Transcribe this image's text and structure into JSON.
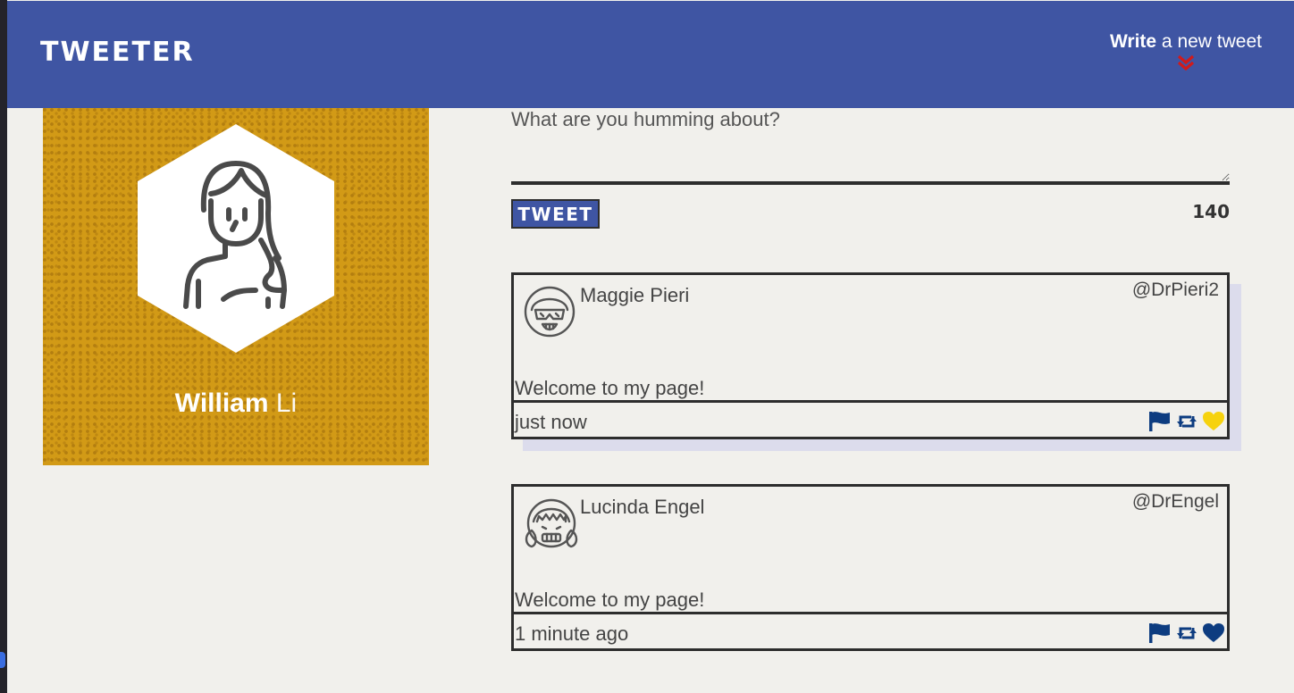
{
  "header": {
    "brand": "TWEETER",
    "compose_bold": "Write",
    "compose_rest": " a new tweet"
  },
  "profile": {
    "first_name": "William",
    "last_name": " Li"
  },
  "composer": {
    "placeholder": "What are you humming about?",
    "submit_label": "TWEET",
    "char_count": "140"
  },
  "tweets": [
    {
      "name": "Maggie Pieri",
      "handle": "@DrPieri2",
      "text": "Welcome to my page!",
      "time": "just now",
      "liked": true
    },
    {
      "name": "Lucinda Engel",
      "handle": "@DrEngel",
      "text": "Welcome to my page!",
      "time": "1 minute ago",
      "liked": false
    }
  ],
  "colors": {
    "header_bg": "#3f55a3",
    "profile_bg": "#d29a16",
    "icon_blue": "#0d3c80",
    "like_active": "#f6d20d",
    "chevron_red": "#d11a1a"
  }
}
